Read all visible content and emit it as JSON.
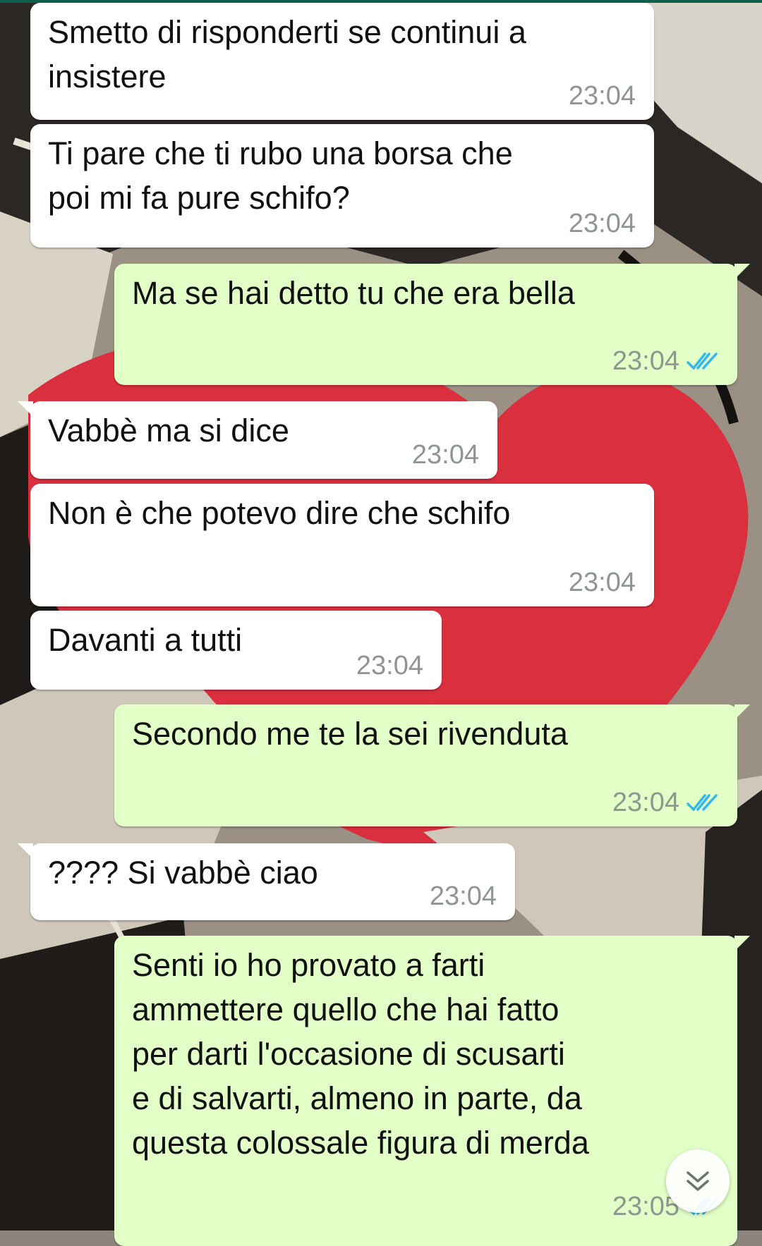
{
  "chat": {
    "messages": [
      {
        "dir": "in",
        "text": "Smetto di risponderti se continui a\ninsistere",
        "time": "23:04"
      },
      {
        "dir": "in",
        "text": "Ti pare che ti rubo una borsa che\npoi mi fa pure schifo?",
        "time": "23:04"
      },
      {
        "dir": "out",
        "text": "Ma se hai detto tu che era bella",
        "time": "23:04",
        "status": "read"
      },
      {
        "dir": "in",
        "text": "Vabbè ma si dice",
        "time": "23:04"
      },
      {
        "dir": "in",
        "text": "Non è che potevo dire che schifo",
        "time": "23:04"
      },
      {
        "dir": "in",
        "text": "Davanti a tutti",
        "time": "23:04"
      },
      {
        "dir": "out",
        "text": "Secondo me te la sei rivenduta",
        "time": "23:04",
        "status": "read"
      },
      {
        "dir": "in",
        "text": "???? Si vabbè ciao",
        "time": "23:04"
      },
      {
        "dir": "out",
        "text": "Senti io ho provato a farti\nammettere quello che hai fatto\nper darti l'occasione di scusarti\ne di salvarti, almeno in parte, da\nquesta colossale figura di merda",
        "time": "23:05",
        "status": "read"
      }
    ]
  },
  "icons": {
    "read_ticks": "double-check-icon",
    "scroll_down": "chevron-double-down-icon"
  },
  "colors": {
    "incoming_bubble": "#ffffff",
    "outgoing_bubble": "#e1ffc7",
    "read_tick": "#34b7f1",
    "timestamp": "#8e9690"
  }
}
